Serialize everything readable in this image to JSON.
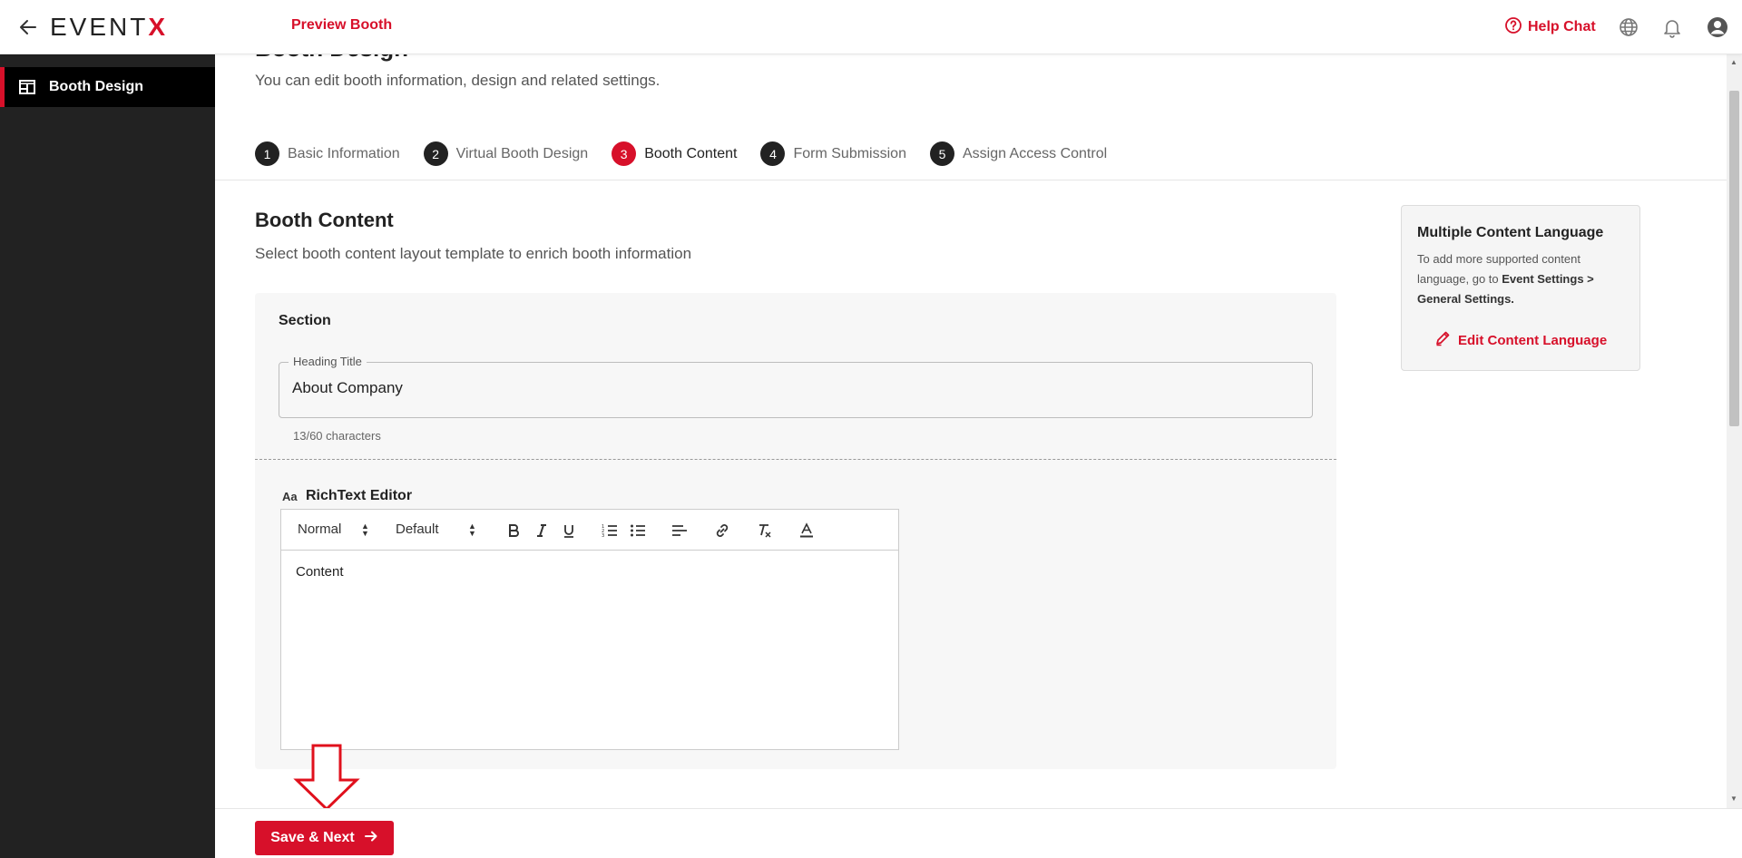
{
  "topbar": {
    "logo_main": "EVENT",
    "logo_accent": "X",
    "preview_label": "Preview Booth",
    "help_label": "Help Chat"
  },
  "sidebar": {
    "items": [
      {
        "label": "Booth Design",
        "icon": "layout-grid-icon",
        "active": true
      }
    ]
  },
  "main": {
    "page_title": "Booth Design",
    "page_subtitle": "You can edit booth information, design and related settings.",
    "steps": [
      {
        "num": "1",
        "label": "Basic Information"
      },
      {
        "num": "2",
        "label": "Virtual Booth Design"
      },
      {
        "num": "3",
        "label": "Booth Content",
        "active": true
      },
      {
        "num": "4",
        "label": "Form Submission"
      },
      {
        "num": "5",
        "label": "Assign Access Control"
      }
    ],
    "section_title": "Booth Content",
    "section_subtitle": "Select booth content layout template to enrich booth information",
    "panel": {
      "label": "Section",
      "heading_field": {
        "legend": "Heading Title",
        "value": "About Company",
        "char_count": "13/60 characters"
      },
      "rte": {
        "icon_text": "Aa",
        "title": "RichText Editor",
        "toolbar": {
          "heading_select": "Normal",
          "font_select": "Default",
          "buttons": [
            "bold-icon",
            "italic-icon",
            "underline-icon",
            "ordered-list-icon",
            "bullet-list-icon",
            "align-icon",
            "link-icon",
            "clear-format-icon",
            "text-color-icon"
          ]
        },
        "content": "Content"
      }
    }
  },
  "info_card": {
    "title": "Multiple Content Language",
    "text_before": "To add more supported content language, go to ",
    "text_bold": "Event Settings > General Settings.",
    "link_label": "Edit Content Language"
  },
  "footer": {
    "save_label": "Save & Next"
  },
  "colors": {
    "accent": "#d7102a",
    "sidebar_bg": "#222222",
    "active_item_bg": "#000000"
  }
}
